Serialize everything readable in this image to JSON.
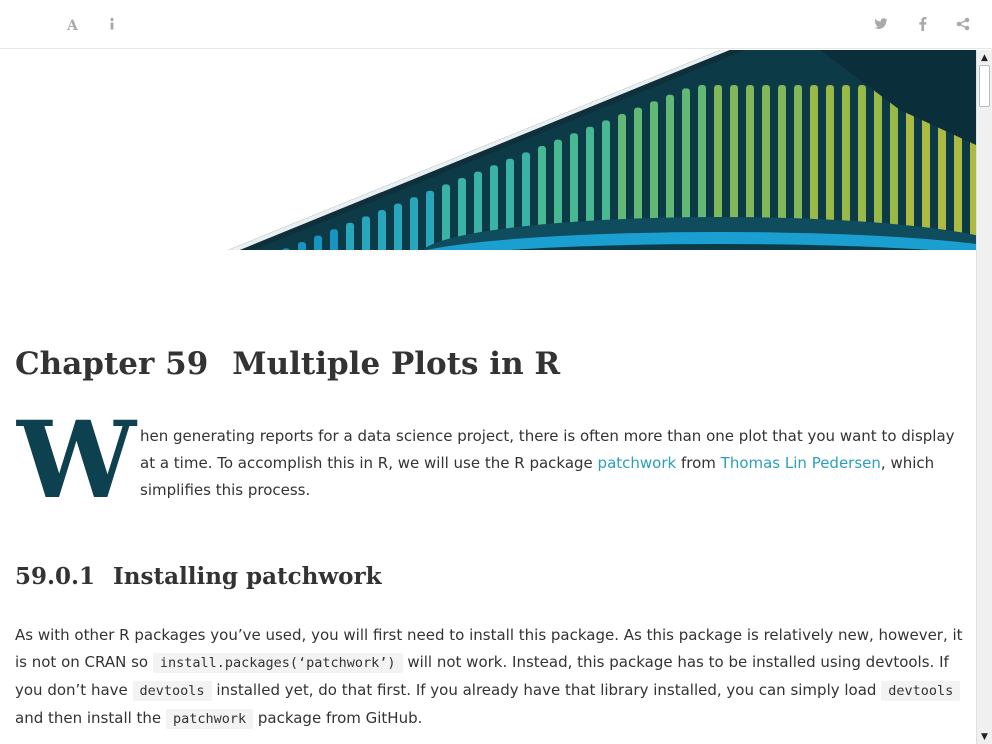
{
  "toolbar": {
    "left_icons": [
      "font-settings-icon",
      "info-icon"
    ],
    "right_icons": [
      "twitter-icon",
      "facebook-icon",
      "share-icon"
    ]
  },
  "chapter": {
    "number": "Chapter 59",
    "title": "Multiple Plots in R"
  },
  "intro": {
    "drop_cap": "W",
    "text_1": "hen generating reports for a data science project, there is often more than one plot that you want to display at a time. To accomplish this in R, we will use the R package ",
    "link_1": "patchwork",
    "text_2": " from ",
    "link_2": "Thomas Lin Pedersen",
    "text_3": ", which simplifies this process."
  },
  "section": {
    "number": "59.0.1",
    "title": "Installing patchwork"
  },
  "install_paragraph": {
    "t1": "As with other R packages you’ve used, you will first need to install this package. As this package is relatively new, however, it is not on CRAN so ",
    "c1": "install.packages(‘patchwork’)",
    "t2": " will not work. Instead, this package has to be installed using devtools. If you don’t have ",
    "c2": "devtools",
    "t3": " installed yet, do that first. If you already have that library installed, you can simply load ",
    "c3": "devtools",
    "t4": " and then install the ",
    "c4": "patchwork",
    "t5": " package from GitHub."
  },
  "colors": {
    "accent_link": "#2a9fbf",
    "dropcap": "#0d4150",
    "banner_dark": "#0d3a47"
  }
}
